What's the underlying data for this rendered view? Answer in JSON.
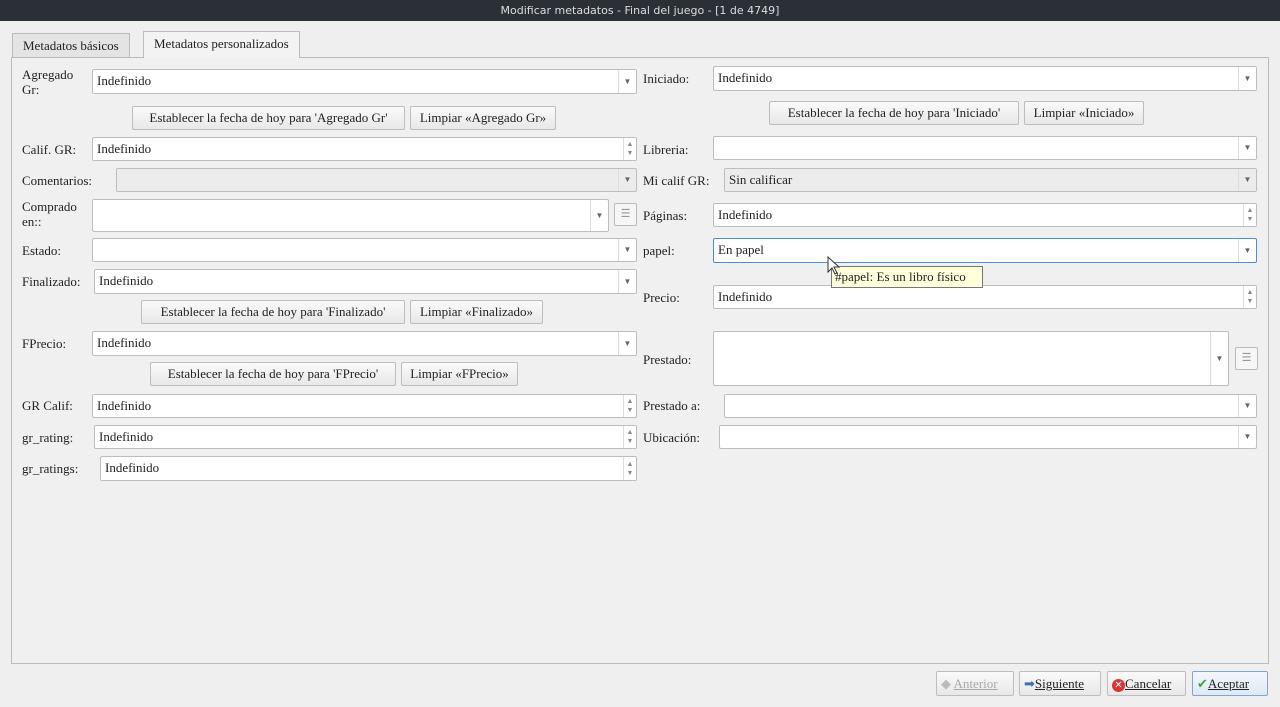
{
  "window": {
    "title": "Modificar metadatos - Final del juego -  [1 de 4749]"
  },
  "tabs": [
    {
      "label": "Metadatos básicos"
    },
    {
      "label": "Metadatos personalizados"
    }
  ],
  "left": {
    "agregado_gr": {
      "label": "Agregado Gr:",
      "value": "Indefinido",
      "set_today": "Establecer la fecha de hoy para 'Agregado Gr'",
      "clear": "Limpiar «Agregado Gr»"
    },
    "calif_gr": {
      "label": "Calif. GR:",
      "value": "Indefinido"
    },
    "comentarios": {
      "label": "Comentarios:",
      "value": ""
    },
    "comprado_en": {
      "label": "Comprado en::",
      "value": ""
    },
    "estado": {
      "label": "Estado:",
      "value": ""
    },
    "finalizado": {
      "label": "Finalizado:",
      "value": "Indefinido",
      "set_today": "Establecer la fecha de hoy para 'Finalizado'",
      "clear": "Limpiar «Finalizado»"
    },
    "fprecio": {
      "label": "FPrecio:",
      "value": "Indefinido",
      "set_today": "Establecer la fecha de hoy para 'FPrecio'",
      "clear": "Limpiar «FPrecio»"
    },
    "gr_calif": {
      "label": "GR Calif:",
      "value": "Indefinido"
    },
    "gr_rating": {
      "label": "gr_rating:",
      "value": "Indefinido"
    },
    "gr_ratings": {
      "label": "gr_ratings:",
      "value": "Indefinido"
    }
  },
  "right": {
    "iniciado": {
      "label": "Iniciado:",
      "value": "Indefinido",
      "set_today": "Establecer la fecha de hoy para 'Iniciado'",
      "clear": "Limpiar «Iniciado»"
    },
    "libreria": {
      "label": "Libreria:",
      "value": ""
    },
    "mi_calif_gr": {
      "label": "Mi calif GR:",
      "value": "Sin calificar"
    },
    "paginas": {
      "label": "Páginas:",
      "value": "Indefinido"
    },
    "papel": {
      "label": "papel:",
      "value": "En papel",
      "tooltip": "#papel: Es un libro físico"
    },
    "precio": {
      "label": "Precio:",
      "value": "Indefinido"
    },
    "prestado": {
      "label": "Prestado:",
      "value": ""
    },
    "prestado_a": {
      "label": "Prestado a:",
      "value": ""
    },
    "ubicacion": {
      "label": "Ubicación:",
      "value": ""
    }
  },
  "footer": {
    "prev": "Anterior",
    "next": "Siguiente",
    "cancel": "Cancelar",
    "ok": "Aceptar"
  },
  "colors": {
    "titlebar": "#2b2f36",
    "focus": "#4a8fd6",
    "tooltip": "#ffffdc"
  }
}
